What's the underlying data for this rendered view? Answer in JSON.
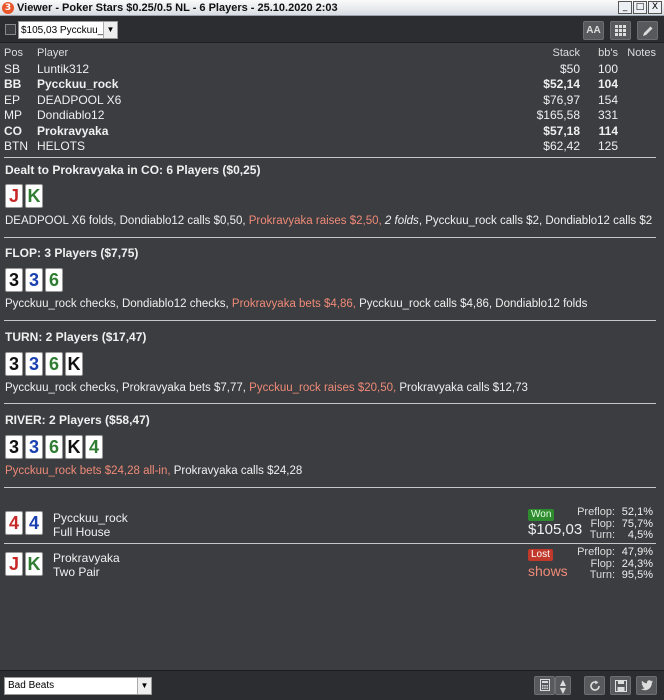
{
  "window": {
    "title": "Viewer - Poker Stars $0.25/0.5 NL - 6 Players - 25.10.2020 2:03",
    "controls": [
      "_",
      "□",
      "X"
    ]
  },
  "toolbar": {
    "hand_select": "$105,03 Pycckuu_r",
    "font_button": "AA"
  },
  "players": {
    "headers": {
      "pos": "Pos",
      "player": "Player",
      "stack": "Stack",
      "bbs": "bb's",
      "notes": "Notes"
    },
    "rows": [
      {
        "pos": "SB",
        "player": "Luntik312",
        "stack": "$50",
        "bbs": "100",
        "bold": false
      },
      {
        "pos": "BB",
        "player": "Pycckuu_rock",
        "stack": "$52,14",
        "bbs": "104",
        "bold": true
      },
      {
        "pos": "EP",
        "player": "DEADPOOL X6",
        "stack": "$76,97",
        "bbs": "154",
        "bold": false
      },
      {
        "pos": "MP",
        "player": "Dondiablo12",
        "stack": "$165,58",
        "bbs": "331",
        "bold": false
      },
      {
        "pos": "CO",
        "player": "Prokravyaka",
        "stack": "$57,18",
        "bbs": "114",
        "bold": true
      },
      {
        "pos": "BTN",
        "player": "HELOTS",
        "stack": "$62,42",
        "bbs": "125",
        "bold": false
      }
    ]
  },
  "colors": {
    "highlight": "#f08a78",
    "club": "#2e7d32",
    "spade": "#111111",
    "diamond": "#1a3fb0",
    "heart": "#c62828"
  },
  "streets": {
    "preflop": {
      "title": "Dealt to Prokravyaka in CO: 6 Players ($0,25)",
      "cards": [
        {
          "rank": "J",
          "color": "#c62828"
        },
        {
          "rank": "K",
          "color": "#2e7d32"
        }
      ],
      "actions": [
        {
          "text": "DEADPOOL X6 folds, Dondiablo12 calls $0,50, ",
          "style": ""
        },
        {
          "text": "Prokravyaka raises $2,50, ",
          "style": "hl"
        },
        {
          "text": "2 folds",
          "style": "it"
        },
        {
          "text": ", Pycckuu_rock calls $2, Dondiablo12 calls $2",
          "style": ""
        }
      ]
    },
    "flop": {
      "title": "FLOP: 3 Players ($7,75)",
      "cards": [
        {
          "rank": "3",
          "color": "#111111"
        },
        {
          "rank": "3",
          "color": "#1a3fb0"
        },
        {
          "rank": "6",
          "color": "#2e7d32"
        }
      ],
      "actions": [
        {
          "text": "Pycckuu_rock checks, Dondiablo12 checks, ",
          "style": ""
        },
        {
          "text": "Prokravyaka bets $4,86, ",
          "style": "hl"
        },
        {
          "text": "Pycckuu_rock calls $4,86, Dondiablo12 folds",
          "style": ""
        }
      ]
    },
    "turn": {
      "title": "TURN: 2 Players ($17,47)",
      "cards": [
        {
          "rank": "3",
          "color": "#111111"
        },
        {
          "rank": "3",
          "color": "#1a3fb0"
        },
        {
          "rank": "6",
          "color": "#2e7d32"
        },
        {
          "rank": "K",
          "color": "#111111"
        }
      ],
      "actions": [
        {
          "text": "Pycckuu_rock checks, Prokravyaka bets $7,77, ",
          "style": ""
        },
        {
          "text": "Pycckuu_rock raises $20,50, ",
          "style": "hl"
        },
        {
          "text": "Prokravyaka calls $12,73",
          "style": ""
        }
      ]
    },
    "river": {
      "title": "RIVER: 2 Players ($58,47)",
      "cards": [
        {
          "rank": "3",
          "color": "#111111"
        },
        {
          "rank": "3",
          "color": "#1a3fb0"
        },
        {
          "rank": "6",
          "color": "#2e7d32"
        },
        {
          "rank": "K",
          "color": "#111111"
        },
        {
          "rank": "4",
          "color": "#2e7d32"
        }
      ],
      "actions": [
        {
          "text": "Pycckuu_rock bets $24,28 all-in, ",
          "style": "hl"
        },
        {
          "text": "Prokravyaka calls $24,28",
          "style": ""
        }
      ]
    }
  },
  "results": [
    {
      "cards": [
        {
          "rank": "4",
          "color": "#c62828"
        },
        {
          "rank": "4",
          "color": "#1a3fb0"
        }
      ],
      "name": "Pycckuu_rock",
      "hand": "Full House",
      "badge": "Won",
      "amount": "$105,03",
      "equity": [
        {
          "label": "Preflop:",
          "value": "52,1%"
        },
        {
          "label": "Flop:",
          "value": "75,7%"
        },
        {
          "label": "Turn:",
          "value": "4,5%"
        }
      ]
    },
    {
      "cards": [
        {
          "rank": "J",
          "color": "#c62828"
        },
        {
          "rank": "K",
          "color": "#2e7d32"
        }
      ],
      "name": "Prokravyaka",
      "hand": "Two Pair",
      "badge": "Lost",
      "amount": "shows",
      "equity": [
        {
          "label": "Preflop:",
          "value": "47,9%"
        },
        {
          "label": "Flop:",
          "value": "24,3%"
        },
        {
          "label": "Turn:",
          "value": "95,5%"
        }
      ]
    }
  ],
  "footer": {
    "filter_select": "Bad Beats",
    "icons": [
      "calculator-icon",
      "sort-icon",
      "refresh-icon",
      "save-icon",
      "twitter-icon"
    ]
  }
}
